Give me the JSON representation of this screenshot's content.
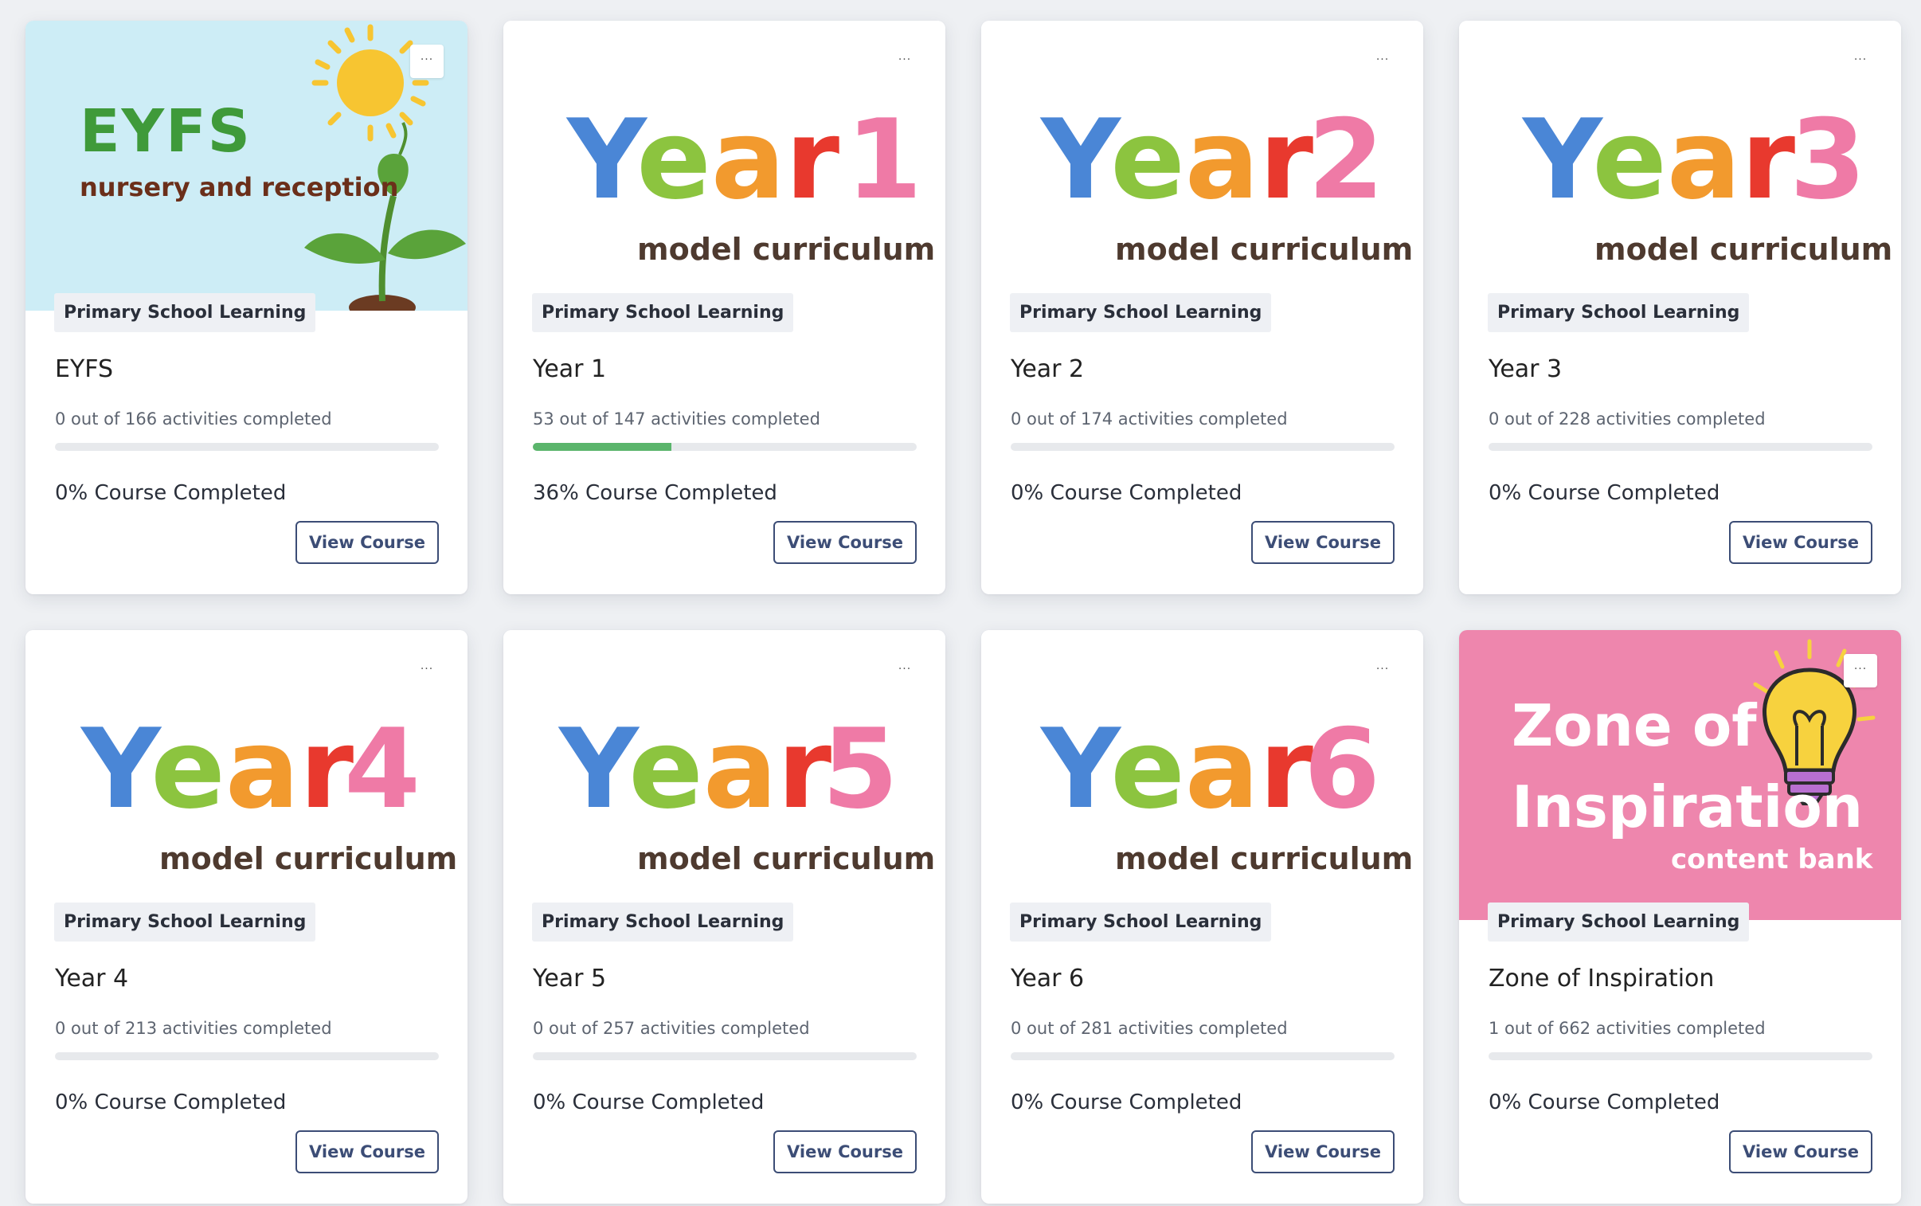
{
  "colors": {
    "year_blue": "#4a86d6",
    "year_green": "#8cc43f",
    "year_orange": "#f29a2e",
    "year_red": "#e8392e",
    "year_pink": "#ef7aa6",
    "subtitle_brown": "#4e3a2f",
    "progress_green": "#5bb56c",
    "button_navy": "#3c4d76"
  },
  "courses": [
    {
      "banner": {
        "type": "eyfs",
        "heading": "EYFS",
        "subheading": "nursery and reception"
      },
      "menu_label": "...",
      "tag": "Primary School Learning",
      "title": "EYFS",
      "activities_text": "0 out of 166 activities completed",
      "progress": 0,
      "completed_text": "0% Course Completed",
      "button_label": "View Course"
    },
    {
      "banner": {
        "type": "year",
        "word": "Year",
        "number": "1",
        "subtitle": "model curriculum"
      },
      "menu_label": "...",
      "tag": "Primary School Learning",
      "title": "Year 1",
      "activities_text": "53 out of 147 activities completed",
      "progress": 0.36,
      "completed_text": "36% Course Completed",
      "button_label": "View Course"
    },
    {
      "banner": {
        "type": "year",
        "word": "Year",
        "number": "2",
        "subtitle": "model curriculum"
      },
      "menu_label": "...",
      "tag": "Primary School Learning",
      "title": "Year 2",
      "activities_text": "0 out of 174 activities completed",
      "progress": 0,
      "completed_text": "0% Course Completed",
      "button_label": "View Course"
    },
    {
      "banner": {
        "type": "year",
        "word": "Year",
        "number": "3",
        "subtitle": "model curriculum"
      },
      "menu_label": "...",
      "tag": "Primary School Learning",
      "title": "Year 3",
      "activities_text": "0 out of 228 activities completed",
      "progress": 0,
      "completed_text": "0% Course Completed",
      "button_label": "View Course"
    },
    {
      "banner": {
        "type": "year",
        "word": "Year",
        "number": "4",
        "subtitle": "model curriculum"
      },
      "menu_label": "...",
      "tag": "Primary School Learning",
      "title": "Year 4",
      "activities_text": "0 out of 213 activities completed",
      "progress": 0,
      "completed_text": "0% Course Completed",
      "button_label": "View Course"
    },
    {
      "banner": {
        "type": "year",
        "word": "Year",
        "number": "5",
        "subtitle": "model curriculum"
      },
      "menu_label": "...",
      "tag": "Primary School Learning",
      "title": "Year 5",
      "activities_text": "0 out of 257 activities completed",
      "progress": 0,
      "completed_text": "0% Course Completed",
      "button_label": "View Course"
    },
    {
      "banner": {
        "type": "year",
        "word": "Year",
        "number": "6",
        "subtitle": "model curriculum"
      },
      "menu_label": "...",
      "tag": "Primary School Learning",
      "title": "Year 6",
      "activities_text": "0 out of 281 activities completed",
      "progress": 0,
      "completed_text": "0% Course Completed",
      "button_label": "View Course"
    },
    {
      "banner": {
        "type": "zone",
        "line1": "Zone of",
        "line2": "Inspiration",
        "line3": "content bank"
      },
      "menu_label": "...",
      "tag": "Primary School Learning",
      "title": "Zone of Inspiration",
      "activities_text": "1 out of 662 activities completed",
      "progress": 0,
      "completed_text": "0% Course Completed",
      "button_label": "View Course"
    }
  ]
}
